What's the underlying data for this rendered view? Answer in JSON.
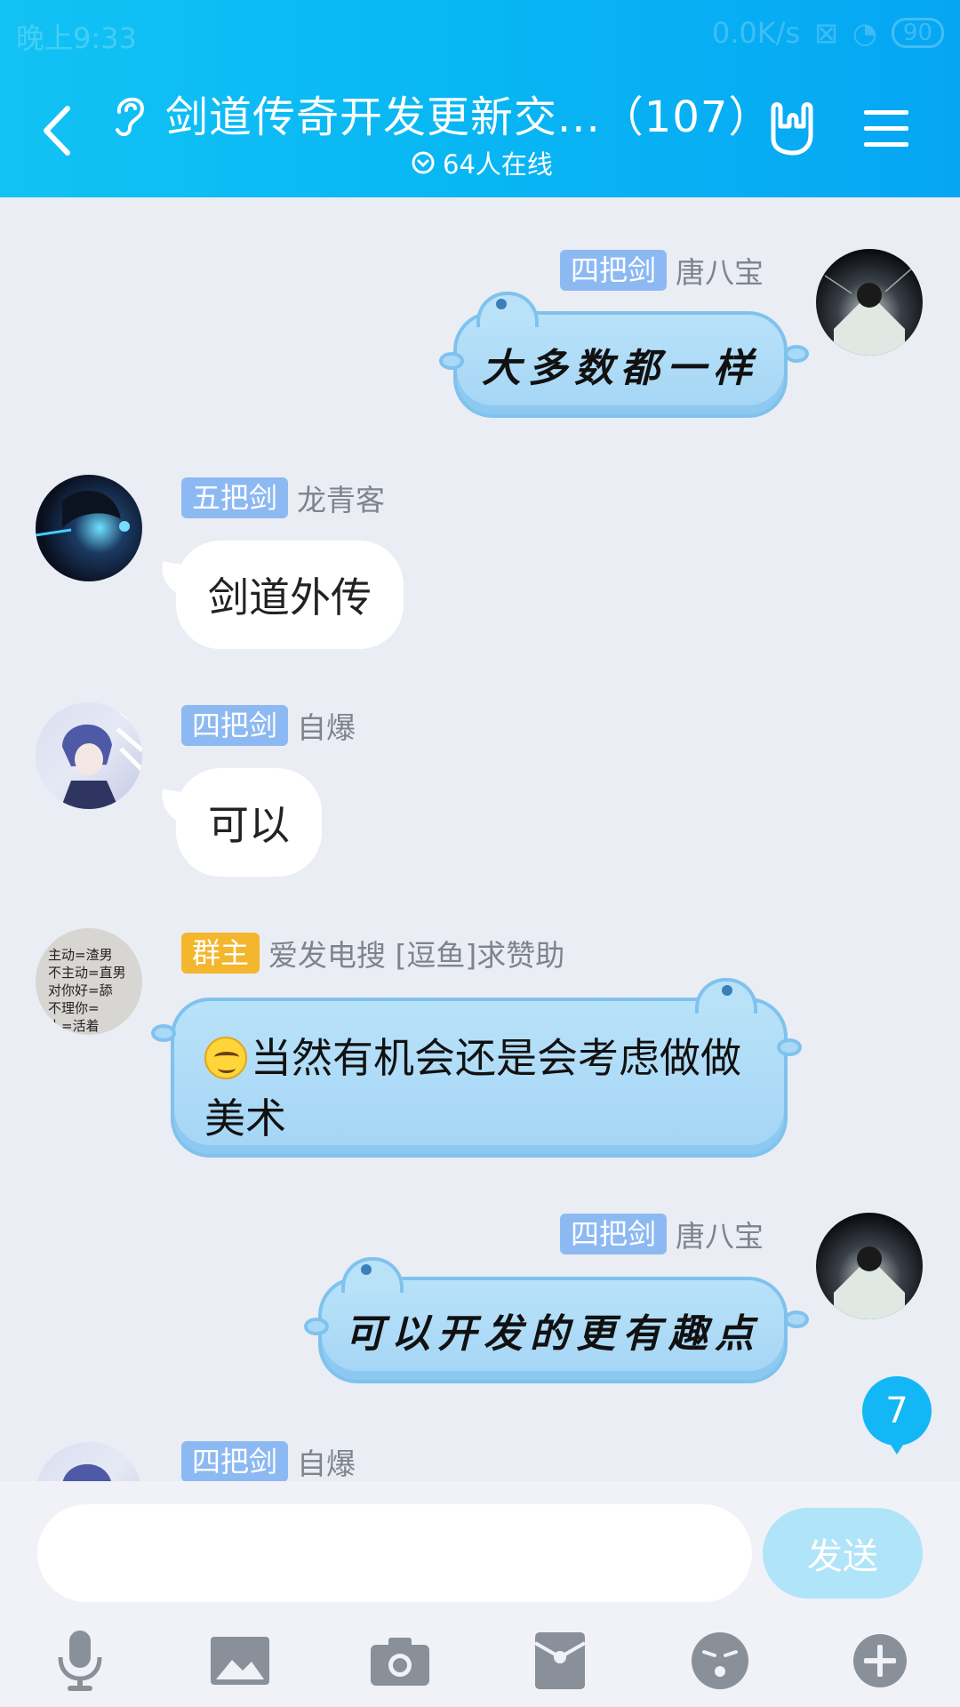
{
  "status_bar": {
    "time": "晚上9:33",
    "speed": "0.0K/s",
    "battery": "90"
  },
  "header": {
    "title": "剑道传奇开发更新交...（107）",
    "online": "64人在线"
  },
  "messages": [
    {
      "badge": "四把剑",
      "name": "唐八宝",
      "text": "大多数都一样",
      "side": "right"
    },
    {
      "badge": "五把剑",
      "name": "龙青客",
      "text": "剑道外传",
      "side": "left"
    },
    {
      "badge": "四把剑",
      "name": "自爆",
      "text": "可以",
      "side": "left"
    },
    {
      "badge": "群主",
      "name": "爱发电搜 [逗鱼]求赞助",
      "text": "当然有机会还是会考虑做做美术",
      "side": "left"
    },
    {
      "badge": "四把剑",
      "name": "唐八宝",
      "text": "可以开发的更有趣点",
      "side": "right"
    },
    {
      "badge": "四把剑",
      "name": "自爆",
      "text": "",
      "side": "left"
    }
  ],
  "avatar_text": [
    "主动=渣男",
    "不主动=直男",
    "对你好=舔",
    "不理你=",
    "人=活着"
  ],
  "unread_count": "7",
  "input": {
    "placeholder": "",
    "send_label": "发送"
  },
  "toolbar": [
    "mic-icon",
    "image-icon",
    "camera-icon",
    "red-packet-icon",
    "emoji-icon",
    "plus-icon"
  ],
  "colors": {
    "header": "#08b6f3",
    "badge_blue": "#8db9f3",
    "badge_owner": "#f3b62c",
    "bubble_blue": "#a4d5f5"
  }
}
